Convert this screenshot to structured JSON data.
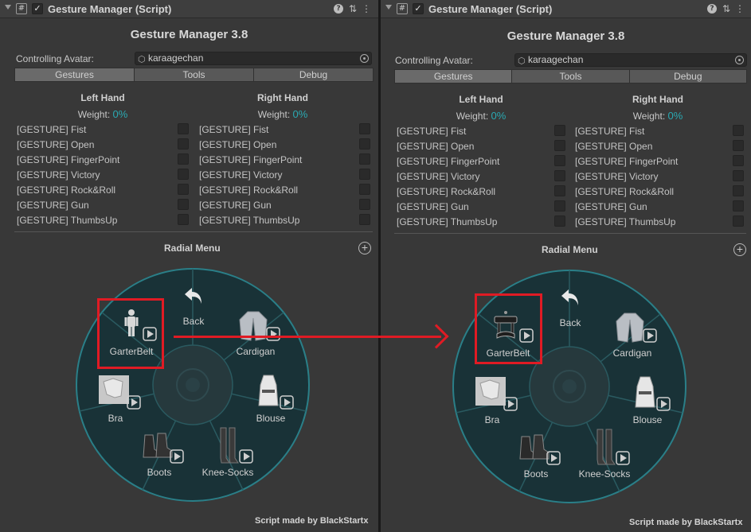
{
  "component": {
    "title": "Gesture Manager (Script)",
    "script_icon": "#",
    "check_mark": "✓",
    "icons": [
      "fold-arrow-icon",
      "script-icon",
      "enabled-checkbox-icon",
      "help-icon",
      "settings-sliders-icon",
      "kebab-menu-icon"
    ]
  },
  "app_title": "Gesture Manager 3.8",
  "controlling_avatar": {
    "label": "Controlling Avatar:",
    "value": "karaagechan"
  },
  "tabs": [
    {
      "label": "Gestures",
      "active": true
    },
    {
      "label": "Tools",
      "active": false
    },
    {
      "label": "Debug",
      "active": false
    }
  ],
  "left_hand": {
    "title": "Left Hand",
    "weight_label": "Weight:",
    "weight_value": "0%"
  },
  "right_hand": {
    "title": "Right Hand",
    "weight_label": "Weight:",
    "weight_value": "0%"
  },
  "gestures": [
    "[GESTURE] Fist",
    "[GESTURE] Open",
    "[GESTURE] FingerPoint",
    "[GESTURE] Victory",
    "[GESTURE] Rock&Roll",
    "[GESTURE] Gun",
    "[GESTURE] ThumbsUp"
  ],
  "radial_menu": {
    "title": "Radial Menu",
    "add_symbol": "+",
    "items": {
      "back": "Back",
      "garterbelt": "GarterBelt",
      "cardigan": "Cardigan",
      "bra": "Bra",
      "blouse": "Blouse",
      "boots": "Boots",
      "knee_socks": "Knee-Socks"
    }
  },
  "footer": "Script made by BlackStartx",
  "colors": {
    "accent": "#2aa9b2",
    "annotation": "#e01b24",
    "panel": "#383838"
  }
}
